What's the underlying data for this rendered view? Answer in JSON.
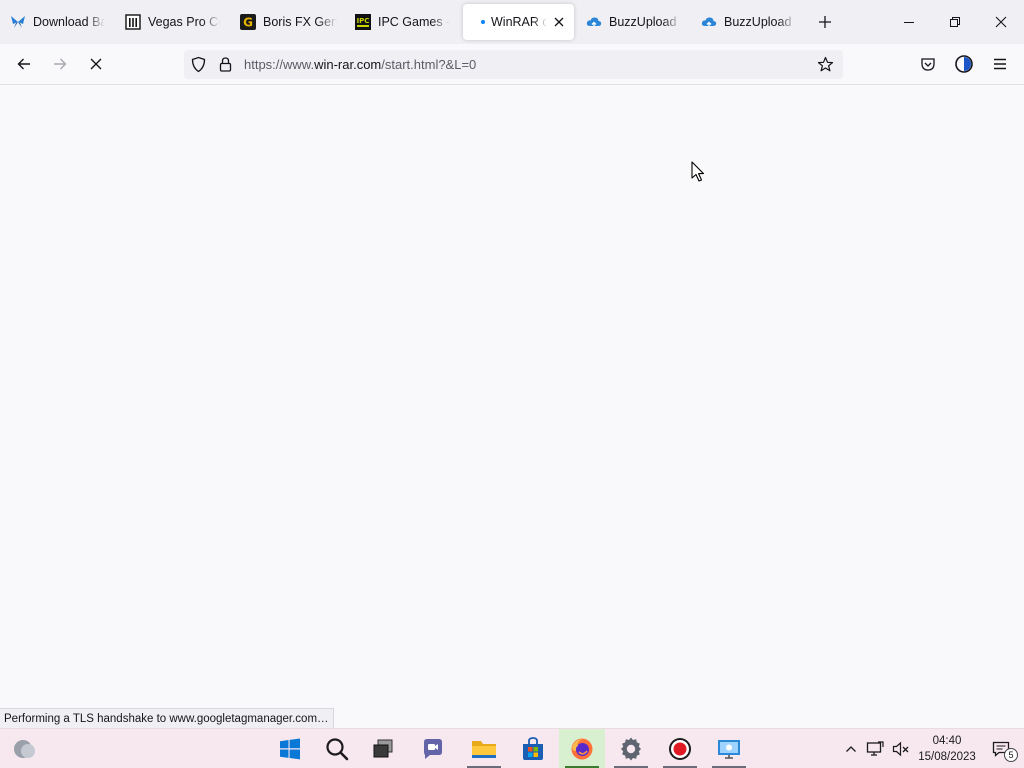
{
  "browser": {
    "tabs": [
      {
        "title": "Download Ba",
        "favicon": "butterfly-icon",
        "active": false
      },
      {
        "title": "Vegas Pro Co",
        "favicon": "building-icon",
        "active": false
      },
      {
        "title": "Boris FX Gena",
        "favicon": "g-logo-icon",
        "active": false
      },
      {
        "title": "IPC Games - I",
        "favicon": "ipc-logo-icon",
        "active": false
      },
      {
        "title": "WinRAR d",
        "favicon": "loading-dot",
        "active": true,
        "loading": true
      },
      {
        "title": "BuzzUpload -",
        "favicon": "cloud-icon",
        "active": false
      },
      {
        "title": "BuzzUpload -",
        "favicon": "cloud-icon",
        "active": false
      }
    ],
    "new_tab_icon": "plus-icon",
    "window_controls": [
      "minimize-icon",
      "restore-icon",
      "close-icon"
    ],
    "url": {
      "prefix": "https://www.",
      "domain": "win-rar.com",
      "path": "/start.html?&L=0"
    },
    "status_text": "Performing a TLS handshake to www.googletagmanager.com…",
    "accent_color": "#0a84ff"
  },
  "taskbar": {
    "clock_time": "04:40",
    "clock_date": "15/08/2023",
    "notification_count": "5",
    "apps": [
      "windows-start-icon",
      "search-icon",
      "task-view-icon",
      "teams-chat-icon",
      "file-explorer-icon",
      "microsoft-store-icon",
      "firefox-icon",
      "settings-icon",
      "recorder-icon",
      "remote-desktop-icon"
    ]
  }
}
